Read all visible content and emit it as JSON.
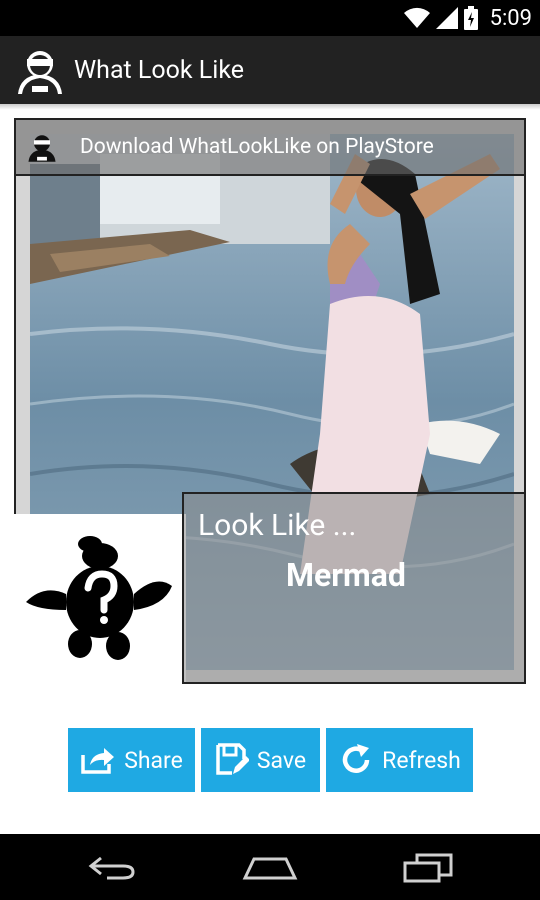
{
  "status_bar": {
    "time": "5:09",
    "icons": [
      "wifi-icon",
      "signal-icon",
      "battery-icon"
    ]
  },
  "action_bar": {
    "title": "What Look Like",
    "logo_icon": "detective-icon"
  },
  "banner": {
    "text": "Download WhatLookLike on PlayStore",
    "icon": "detective-icon"
  },
  "result": {
    "label": "Look Like ...",
    "value": "Mermad",
    "silhouette_icon": "question-mark-turtle-icon"
  },
  "buttons": [
    {
      "label": "Share",
      "icon": "share-icon"
    },
    {
      "label": "Save",
      "icon": "save-icon"
    },
    {
      "label": "Refresh",
      "icon": "refresh-icon"
    }
  ],
  "nav_bar": {
    "icons": [
      "back-icon",
      "home-icon",
      "recent-apps-icon"
    ]
  },
  "colors": {
    "action_bar": "#222222",
    "button": "#1fa9e3"
  }
}
